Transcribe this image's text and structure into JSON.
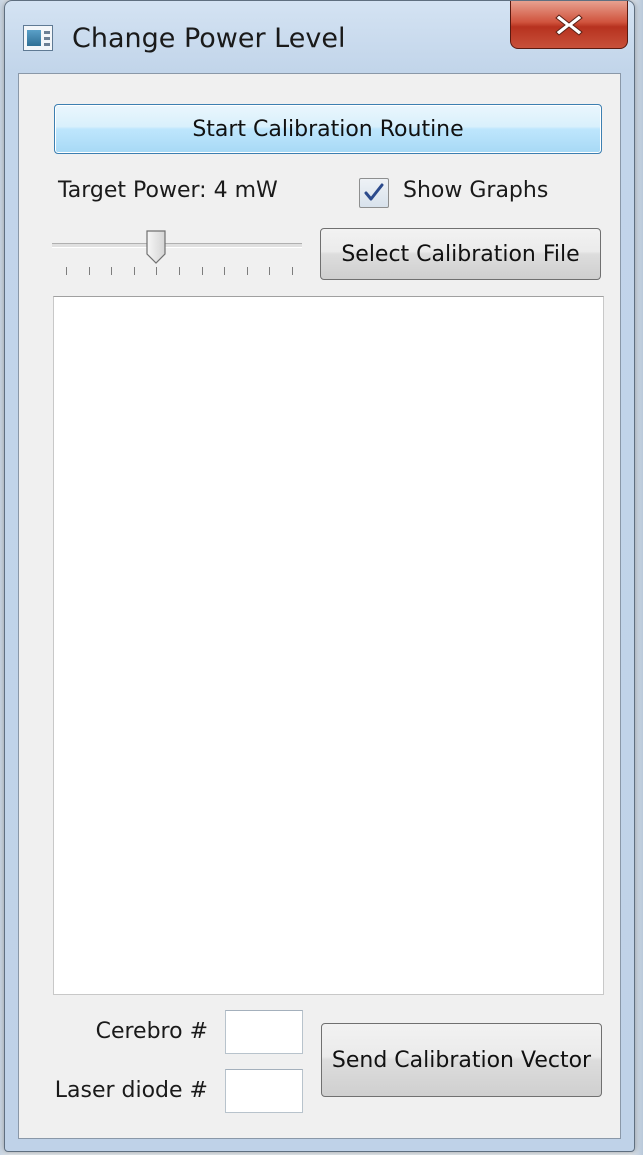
{
  "window": {
    "title": "Change Power Level",
    "icon": "app-window-icon",
    "close_icon": "close-icon"
  },
  "calibration": {
    "start_button_label": "Start Calibration Routine",
    "target_power_label": "Target Power: 4 mW",
    "target_power_value_mW": 4,
    "slider": {
      "min": 0,
      "max": 10,
      "value": 4,
      "tick_count": 11
    },
    "show_graphs": {
      "label": "Show Graphs",
      "checked": true
    },
    "select_file_button_label": "Select Calibration File"
  },
  "bottom": {
    "cerebro_label": "Cerebro #",
    "cerebro_value": "",
    "laser_label": "Laser diode #",
    "laser_value": "",
    "send_button_label": "Send Calibration Vector"
  },
  "colors": {
    "primary_button": "#bee6fd",
    "primary_border": "#3c7fb1",
    "close_button": "#c8503a",
    "checkmark": "#2b4a8c"
  }
}
